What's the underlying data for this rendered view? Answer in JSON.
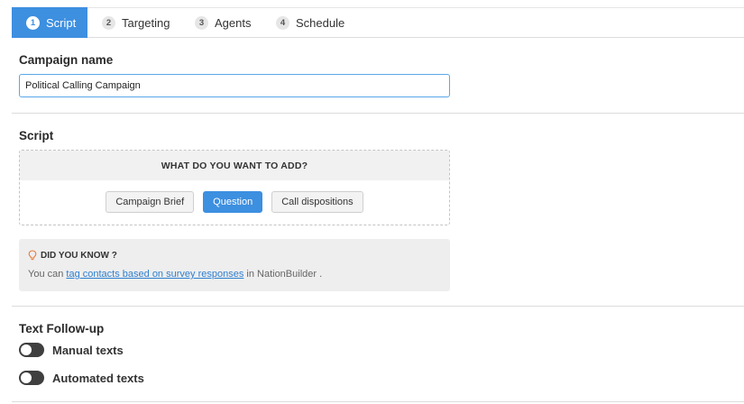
{
  "tabs": [
    {
      "number": "1",
      "label": "Script",
      "active": true
    },
    {
      "number": "2",
      "label": "Targeting",
      "active": false
    },
    {
      "number": "3",
      "label": "Agents",
      "active": false
    },
    {
      "number": "4",
      "label": "Schedule",
      "active": false
    }
  ],
  "campaign": {
    "label": "Campaign name",
    "value": "Political Calling Campaign"
  },
  "script": {
    "label": "Script",
    "box_heading": "WHAT DO YOU WANT TO ADD?",
    "buttons": {
      "brief": "Campaign Brief",
      "question": "Question",
      "dispositions": "Call dispositions"
    }
  },
  "tip": {
    "title": "DID YOU KNOW ?",
    "text_before": "You can ",
    "link_text": "tag contacts based on survey responses",
    "text_after": " in NationBuilder ."
  },
  "followup": {
    "label": "Text Follow-up",
    "manual_label": "Manual texts",
    "automated_label": "Automated texts",
    "manual_on": false,
    "automated_on": false
  },
  "colors": {
    "accent": "#3d8fe0",
    "link": "#2f7fd0",
    "tip_icon": "#e8793a",
    "toggle_off": "#3f3f3f"
  },
  "icons": {
    "tip": "lightbulb-icon"
  }
}
